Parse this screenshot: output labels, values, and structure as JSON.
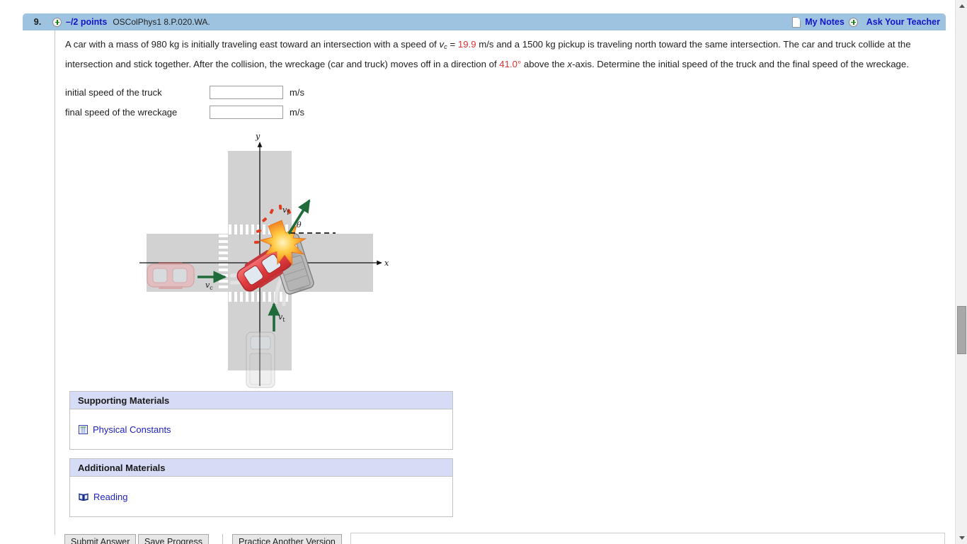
{
  "header": {
    "question_number": "9.",
    "plus_icon": "plus-circle-icon",
    "points": "–/2 points",
    "question_code": "OSColPhys1 8.P.020.WA.",
    "my_notes_label": "My Notes",
    "my_notes_icon": "note-page-icon",
    "ask_teacher_label": "Ask Your Teacher",
    "ask_teacher_icon": "plus-circle-icon",
    "bar_color": "#9dc3e0",
    "link_color": "#1515c8"
  },
  "prompt": {
    "part1": "A car with a mass of 980 kg is initially traveling east toward an intersection with a speed of ",
    "v_c_symbol": "v",
    "v_c_sub": "c",
    "equals": " = ",
    "speed_value": "19.9",
    "part2": " m/s and a 1500 kg pickup is traveling north toward the same intersection. The car and truck collide at the intersection and stick together. After the collision, the wreckage (car and truck) moves off in a direction of ",
    "angle_value": "41.0°",
    "part3": " above the ",
    "x_symbol": "x",
    "part4": "-axis. Determine the initial speed of the truck and the final speed of the wreckage.",
    "highlight_color": "#e03030"
  },
  "answers": [
    {
      "label": "initial speed of the truck",
      "value": "",
      "placeholder": "",
      "unit": "m/s"
    },
    {
      "label": "final speed of the wreckage",
      "value": "",
      "placeholder": "",
      "unit": "m/s"
    }
  ],
  "figure": {
    "name": "intersection-collision-diagram",
    "axis_y_label": "y",
    "axis_x_label": "x",
    "car_velocity_label": "v",
    "car_velocity_sub": "c",
    "truck_velocity_label": "v",
    "truck_velocity_sub": "t",
    "final_velocity_label": "v",
    "final_velocity_sub": "f",
    "angle_label": "θ",
    "road_color": "#d2d2d2",
    "car_color": "#e84f52",
    "truck_color": "#a8a8a8",
    "arrow_color": "#1f6b3a",
    "burst_color": "#f5a623"
  },
  "materials": [
    {
      "section_title": "Supporting Materials",
      "link_label": "Physical Constants",
      "link_icon": "table-grid-icon"
    },
    {
      "section_title": "Additional Materials",
      "link_label": "Reading",
      "link_icon": "open-book-icon"
    }
  ],
  "buttons": {
    "submit_label": "Submit Answer",
    "save_label": "Save Progress",
    "practice_label": "Practice Another Version"
  },
  "scrollbar": {
    "up_arrow_icon": "triangle-up-icon",
    "down_arrow_icon": "triangle-down-icon",
    "thumb": "scroll-thumb"
  }
}
